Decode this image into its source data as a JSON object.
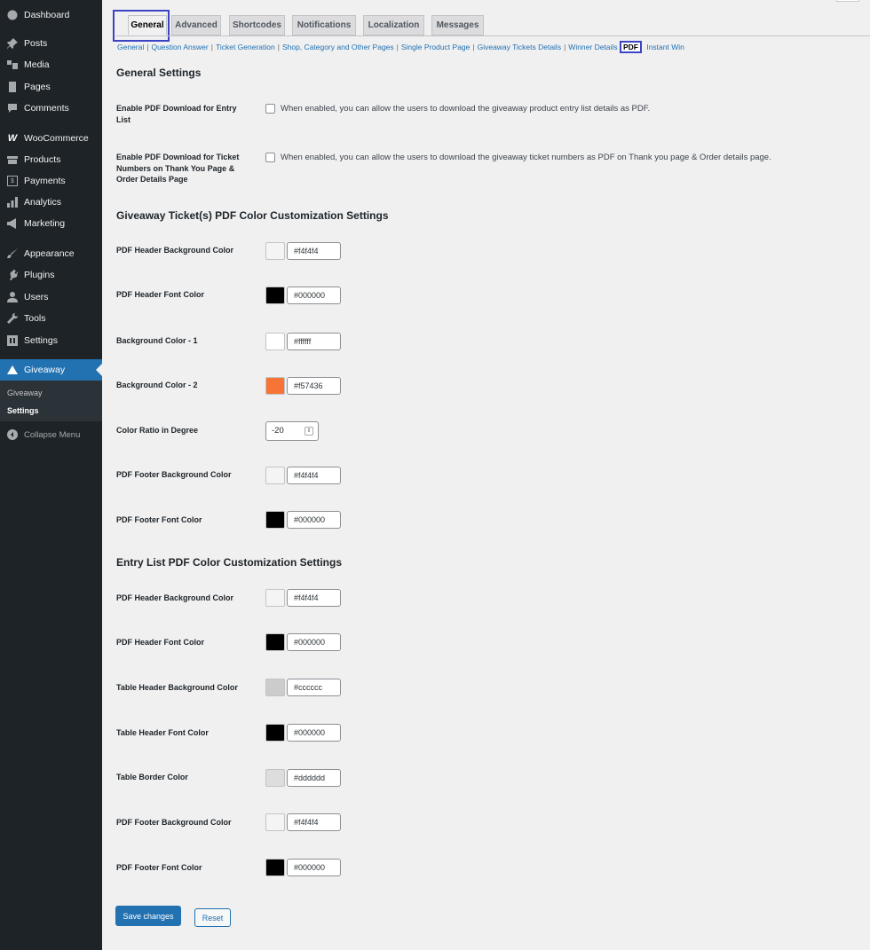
{
  "sidebar": {
    "items": [
      {
        "label": "Dashboard",
        "icon": "dashboard-icon"
      },
      {
        "label": "Posts",
        "icon": "pin-icon"
      },
      {
        "label": "Media",
        "icon": "media-icon"
      },
      {
        "label": "Pages",
        "icon": "pages-icon"
      },
      {
        "label": "Comments",
        "icon": "comment-icon"
      },
      {
        "label": "WooCommerce",
        "icon": "woocommerce-icon"
      },
      {
        "label": "Products",
        "icon": "archive-icon"
      },
      {
        "label": "Payments",
        "icon": "money-icon"
      },
      {
        "label": "Analytics",
        "icon": "chart-bar-icon"
      },
      {
        "label": "Marketing",
        "icon": "megaphone-icon"
      },
      {
        "label": "Appearance",
        "icon": "brush-icon"
      },
      {
        "label": "Plugins",
        "icon": "plug-icon"
      },
      {
        "label": "Users",
        "icon": "users-icon"
      },
      {
        "label": "Tools",
        "icon": "wrench-icon"
      },
      {
        "label": "Settings",
        "icon": "settings-icon"
      },
      {
        "label": "Giveaway",
        "icon": "giveaway-icon"
      }
    ],
    "submenu": [
      "Giveaway",
      "Settings"
    ],
    "collapse_label": "Collapse Menu"
  },
  "tabs": [
    "General",
    "Advanced",
    "Shortcodes",
    "Notifications",
    "Localization",
    "Messages"
  ],
  "sections": [
    "General",
    "Question Answer",
    "Ticket Generation",
    "Shop, Category and Other Pages",
    "Single Product Page",
    "Giveaway Tickets Details",
    "Winner Details",
    "PDF",
    "Instant Win"
  ],
  "current_section": "PDF",
  "general_settings": {
    "heading": "General Settings",
    "rows": [
      {
        "label": "Enable PDF Download for Entry List",
        "description": "When enabled, you can allow the users to download the giveaway product entry list details as PDF.",
        "checked": false
      },
      {
        "label": "Enable PDF Download for Ticket Numbers on Thank You Page & Order Details Page",
        "description": "When enabled, you can allow the users to download the giveaway ticket numbers as PDF on Thank you page & Order details page.",
        "checked": false
      }
    ]
  },
  "ticket_pdf": {
    "heading": "Giveaway Ticket(s) PDF Color Customization Settings",
    "rows": [
      {
        "label": "PDF Header Background Color",
        "value": "#f4f4f4"
      },
      {
        "label": "PDF Header Font Color",
        "value": "#000000"
      },
      {
        "label": "Background Color - 1",
        "value": "#ffffff"
      },
      {
        "label": "Background Color - 2",
        "value": "#f57436"
      },
      {
        "label": "Color Ratio in Degree",
        "value": "-20"
      },
      {
        "label": "PDF Footer Background Color",
        "value": "#f4f4f4"
      },
      {
        "label": "PDF Footer Font Color",
        "value": "#000000"
      }
    ]
  },
  "entry_pdf": {
    "heading": "Entry List PDF Color Customization Settings",
    "rows": [
      {
        "label": "PDF Header Background Color",
        "value": "#f4f4f4"
      },
      {
        "label": "PDF Header Font Color",
        "value": "#000000"
      },
      {
        "label": "Table Header Background Color",
        "value": "#cccccc"
      },
      {
        "label": "Table Header Font Color",
        "value": "#000000"
      },
      {
        "label": "Table Border Color",
        "value": "#dddddd"
      },
      {
        "label": "PDF Footer Background Color",
        "value": "#f4f4f4"
      },
      {
        "label": "PDF Footer Font Color",
        "value": "#000000"
      }
    ]
  },
  "buttons": {
    "save": "Save changes",
    "reset": "Reset"
  },
  "colors": {
    "accent": "#2271b1",
    "sidebar_bg": "#1d2327",
    "highlight": "#3d44c4"
  }
}
